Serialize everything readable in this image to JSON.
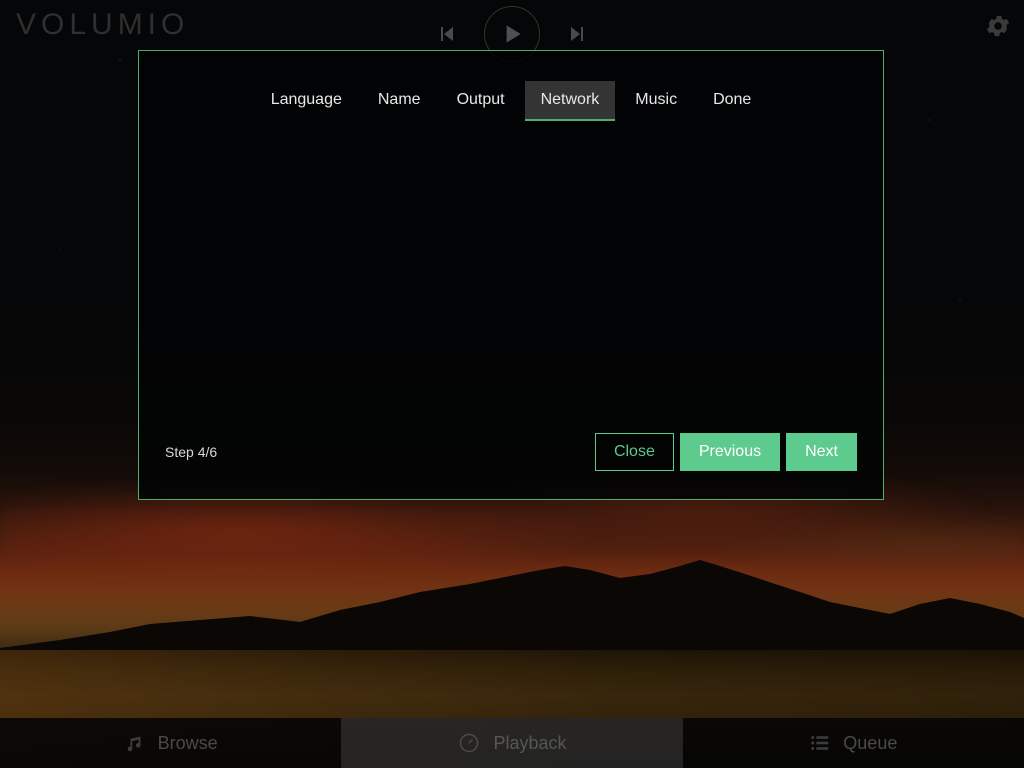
{
  "app": {
    "logo_text": "Volumio"
  },
  "header": {
    "previous_icon": "skip-previous-icon",
    "play_icon": "play-icon",
    "next_icon": "skip-next-icon",
    "settings_icon": "gear-icon"
  },
  "wizard": {
    "tabs": [
      {
        "label": "Language",
        "active": false
      },
      {
        "label": "Name",
        "active": false
      },
      {
        "label": "Output",
        "active": false
      },
      {
        "label": "Network",
        "active": true
      },
      {
        "label": "Music",
        "active": false
      },
      {
        "label": "Done",
        "active": false
      }
    ],
    "step_label": "Step 4/6",
    "buttons": {
      "close": "Close",
      "previous": "Previous",
      "next": "Next"
    },
    "colors": {
      "border": "#4fae6e",
      "accent_green": "#5ccb8d",
      "active_tab_bg": "#343434"
    }
  },
  "bottom_nav": {
    "items": [
      {
        "label": "Browse",
        "icon": "music-note-icon",
        "active": false
      },
      {
        "label": "Playback",
        "icon": "disc-clock-icon",
        "active": true
      },
      {
        "label": "Queue",
        "icon": "list-icon",
        "active": false
      }
    ]
  }
}
